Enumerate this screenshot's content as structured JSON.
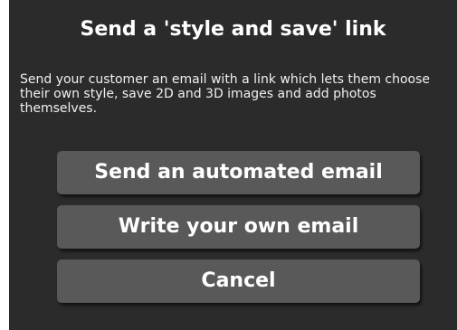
{
  "dialog": {
    "title": "Send a 'style and save' link",
    "description": "Send your customer an email with a link which lets them choose their own style, save 2D and 3D images and add photos themselves.",
    "buttons": {
      "automated_email": "Send an automated email",
      "own_email": "Write your own email",
      "cancel": "Cancel"
    }
  },
  "colors": {
    "dialog_background": "#2b2b2b",
    "button_background": "#595959",
    "text": "#ffffff"
  }
}
